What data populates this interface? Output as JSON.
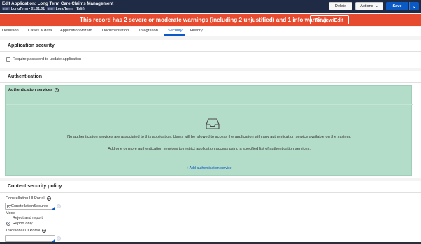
{
  "header": {
    "title": "Edit Application: Long Term Care Claims Management",
    "chip1": "Edit",
    "app_version": "LongTerm • 01.01.01",
    "chip2": "Edit",
    "branch": "LongTerm",
    "mode": "(Edit)",
    "buttons": {
      "delete": "Delete",
      "actions": "Actions",
      "save": "Save"
    }
  },
  "warning": {
    "message": "This record has 2 severe or moderate warnings (including 2 unjustified) and 1 info warning",
    "review_label": "Review/Edit"
  },
  "tabs": [
    {
      "label": "Definition"
    },
    {
      "label": "Cases & data"
    },
    {
      "label": "Application wizard"
    },
    {
      "label": "Documentation"
    },
    {
      "label": "Integration"
    },
    {
      "label": "Security",
      "active": true
    },
    {
      "label": "History"
    }
  ],
  "application_security": {
    "heading": "Application security",
    "require_password_label": "Require password to update application",
    "require_password_checked": false
  },
  "authentication": {
    "heading": "Authentication",
    "services_heading": "Authentication services",
    "help_icon": "?",
    "empty_line1": "No authentication services are associated to this application. Users will be allowed to access the application with any authentication service available on the system.",
    "empty_line2": "Add one or more authentication services to restrict application access using a specified list of authentication services.",
    "add_label": "+ Add authentication service",
    "panel_color": "#b3dcc9"
  },
  "content_security": {
    "heading": "Content security policy",
    "constellation_label": "Constellation UI Portal",
    "constellation_value": "pyConstellationSecured",
    "mode_label": "Mode",
    "mode_options": [
      "Reject and report",
      "Report only"
    ],
    "mode_selected": "Report only",
    "traditional_label": "Traditional UI Portal",
    "traditional_value": ""
  },
  "colors": {
    "header_bg": "#1f2a44",
    "warning_bg": "#e64b2f",
    "accent": "#0a59c4"
  }
}
